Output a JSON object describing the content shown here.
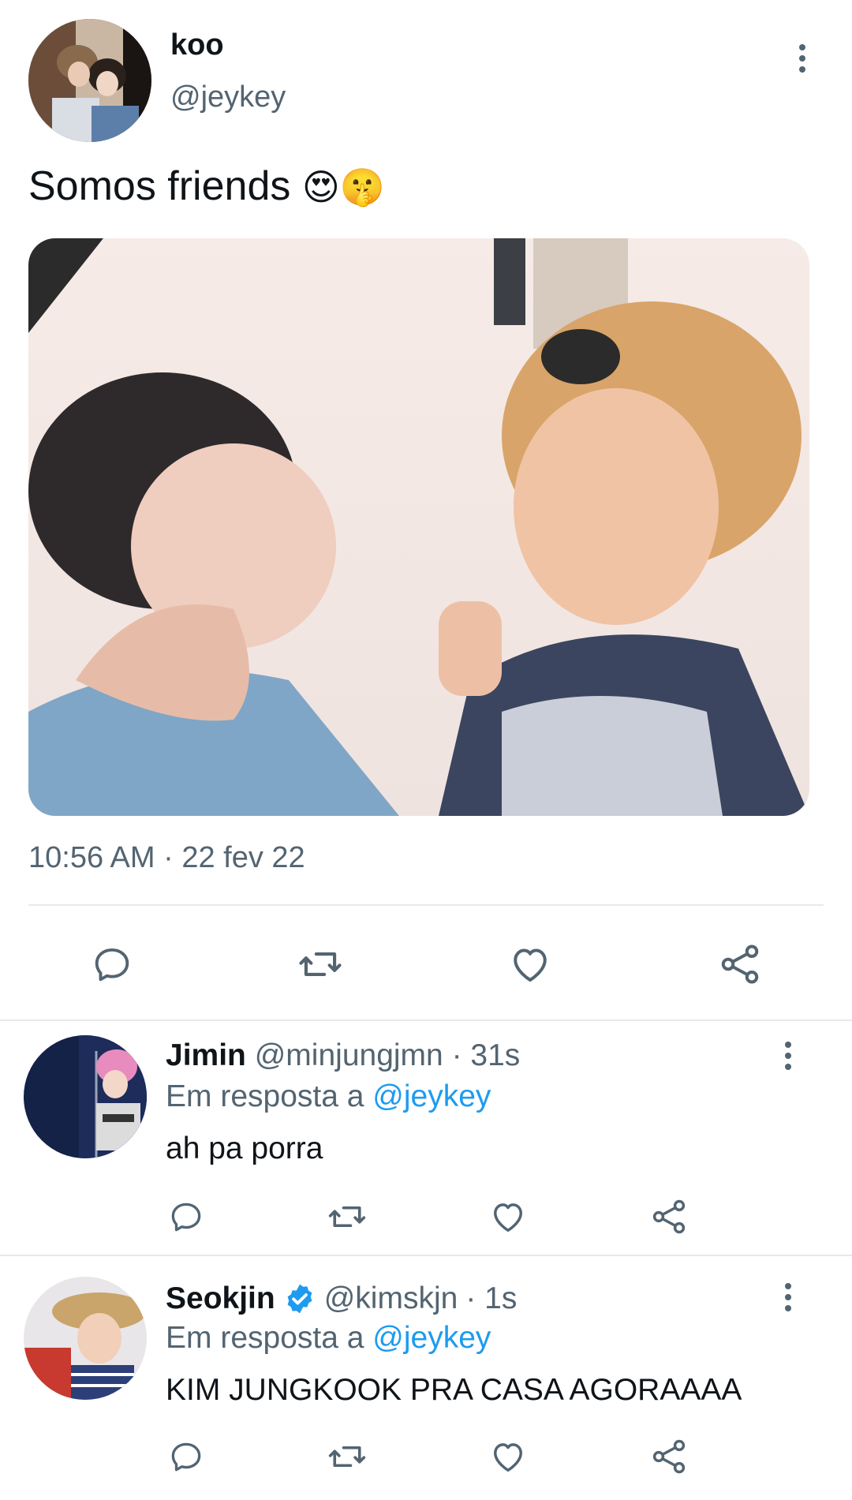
{
  "main_tweet": {
    "author_name": "koo",
    "author_handle": "@jeykey",
    "text": "Somos friends",
    "emoji": "😍🤫",
    "timestamp": "10:56 AM · 22 fev 22"
  },
  "replies": [
    {
      "author_name": "Jimin",
      "author_handle": "@minjungjmn",
      "time": "· 31s",
      "reply_prefix": "Em resposta a",
      "reply_to": "@jeykey",
      "text": "ah pa porra",
      "verified": false
    },
    {
      "author_name": "Seokjin",
      "author_handle": "@kimskjn",
      "time": "· 1s",
      "reply_prefix": "Em resposta a",
      "reply_to": "@jeykey",
      "text": "KIM JUNGKOOK PRA CASA AGORAAAA",
      "verified": true
    }
  ],
  "icons": [
    "reply-icon",
    "retweet-icon",
    "like-icon",
    "share-icon",
    "more-icon",
    "verified-badge-icon"
  ],
  "colors": {
    "text": "#0f1419",
    "muted": "#536471",
    "link": "#1d9bf0",
    "divider": "#e6e9ec"
  }
}
